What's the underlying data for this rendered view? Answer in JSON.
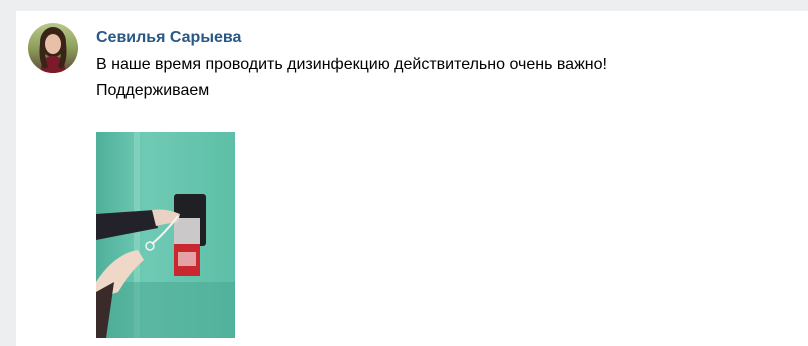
{
  "comment": {
    "author": "Севилья Сарыева",
    "text_lines": [
      "В наше время проводить дизинфекцию действительно очень важно!",
      "Поддерживаем"
    ],
    "avatar_icon": "user-avatar-photo",
    "attachment_icon": "attached-photo-sanitizer-dispenser"
  },
  "colors": {
    "page_background": "#edeef0",
    "card_background": "#ffffff",
    "author_link": "#2a5885",
    "text": "#000000"
  }
}
